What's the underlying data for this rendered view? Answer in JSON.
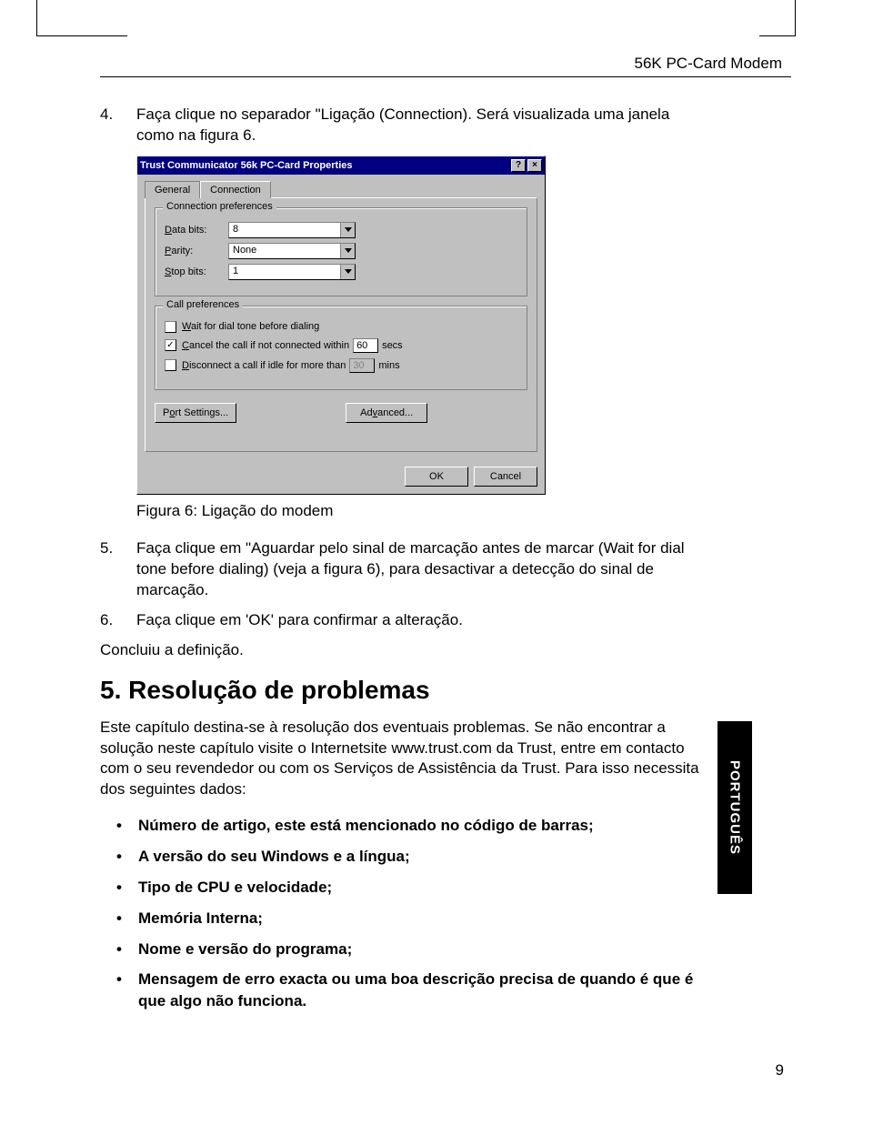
{
  "header": {
    "product": "56K PC-Card Modem"
  },
  "steps": {
    "s4_num": "4.",
    "s4_text": "Faça clique no separador \"Ligação (Connection). Será visualizada uma janela como na figura 6.",
    "figcaption": "Figura 6: Ligação do modem",
    "s5_num": "5.",
    "s5_text": "Faça clique em \"Aguardar pelo sinal de marcação antes de marcar (Wait for dial tone before dialing) (veja a figura 6), para desactivar a detecção do sinal de marcação.",
    "s6_num": "6.",
    "s6_text": "Faça clique em 'OK' para confirmar a alteração.",
    "concl": "Concluiu a definição."
  },
  "dialog": {
    "title": "Trust Communicator 56k PC-Card Properties",
    "help": "?",
    "close": "×",
    "tab_general": "General",
    "tab_connection": "Connection",
    "group_conn": "Connection preferences",
    "lbl_databits_pre": "D",
    "lbl_databits_post": "ata bits:",
    "val_databits": "8",
    "lbl_parity_pre": "P",
    "lbl_parity_post": "arity:",
    "val_parity": "None",
    "lbl_stopbits_pre": "S",
    "lbl_stopbits_post": "top bits:",
    "val_stopbits": "1",
    "group_call": "Call preferences",
    "chk_wait_pre": "W",
    "chk_wait_post": "ait for dial tone before dialing",
    "chk_cancel_pre": "C",
    "chk_cancel_post": "ancel the call if not connected within",
    "val_cancel": "60",
    "unit_secs": "secs",
    "chk_disc_pre": "D",
    "chk_disc_post": "isconnect a call if idle for more than",
    "val_disc": "30",
    "unit_mins": "mins",
    "btn_port_pre": "P",
    "btn_port_mid": "o",
    "btn_port_post": "rt Settings...",
    "btn_adv_pre": "Ad",
    "btn_adv_mid": "v",
    "btn_adv_post": "anced...",
    "btn_ok": "OK",
    "btn_cancel": "Cancel"
  },
  "section5": {
    "heading": "5. Resolução de problemas",
    "intro": "Este capítulo destina-se à resolução dos eventuais problemas. Se não encontrar a solução neste capítulo visite o Internetsite www.trust.com da Trust, entre em contacto com o seu revendedor ou com os Serviços de Assistência da Trust. Para isso necessita dos seguintes dados:",
    "b1": "Número de artigo, este está mencionado no código de barras;",
    "b2": "A versão do seu Windows e a língua;",
    "b3": "Tipo de CPU e velocidade;",
    "b4": "Memória Interna;",
    "b5": "Nome e versão do programa;",
    "b6": "Mensagem de erro exacta ou uma boa descrição precisa de quando é que é que algo não funciona."
  },
  "sidebar": "PORTUGUÊS",
  "pagenum": "9"
}
